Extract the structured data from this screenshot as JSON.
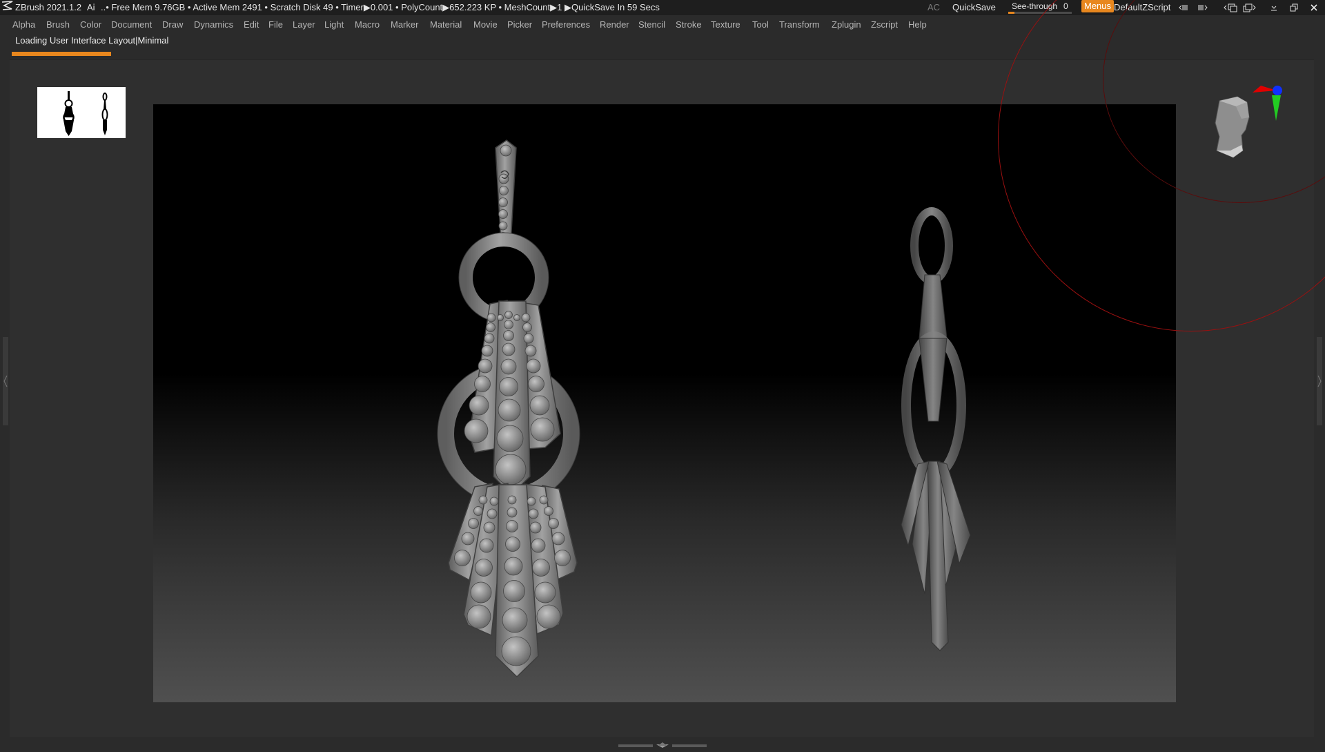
{
  "titlebar": {
    "app_title": "ZBrush 2021.1.2",
    "ai_label": "Ai",
    "status": "..• Free Mem 9.76GB • Active Mem 2491 • Scratch Disk 49 •  Timer▶0.001 • PolyCount▶652.223 KP  • MeshCount▶1  ▶QuickSave In 59 Secs",
    "ac_label": "AC",
    "quicksave_label": "QuickSave",
    "seethrough_label": "See-through",
    "seethrough_value": "0",
    "seethrough_fill": 0.1,
    "menus_label": "Menus",
    "zscript_label": "DefaultZScript"
  },
  "menus": [
    "Alpha",
    "Brush",
    "Color",
    "Document",
    "Draw",
    "Dynamics",
    "Edit",
    "File",
    "Layer",
    "Light",
    "Macro",
    "Marker",
    "Material",
    "Movie",
    "Picker",
    "Preferences",
    "Render",
    "Stencil",
    "Stroke",
    "Texture",
    "Tool",
    "Transform",
    "Zplugin",
    "Zscript",
    "Help"
  ],
  "notify": {
    "message": "Loading User Interface Layout|Minimal",
    "progress": 1.0
  },
  "colors": {
    "accent": "#e8871e",
    "model": "#8c8c8c",
    "axis_x": "#e00000",
    "axis_y": "#22cc22",
    "axis_z": "#1030ff",
    "rotation_ring": "#9a1010"
  },
  "icons": {
    "logo": "zbrush-logo-icon",
    "navigator": "head-navigator-icon"
  }
}
